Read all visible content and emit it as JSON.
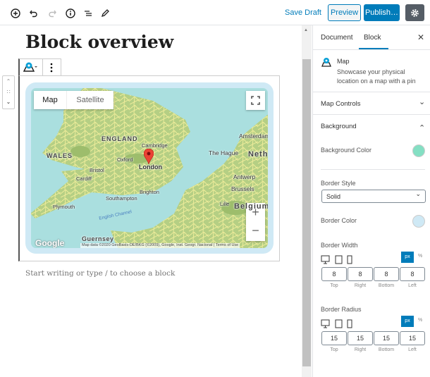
{
  "toolbar": {
    "icons": [
      "add-block-icon",
      "undo-icon",
      "redo-icon",
      "info-icon",
      "list-view-icon",
      "edit-icon"
    ],
    "save_draft": "Save Draft",
    "preview": "Preview",
    "publish": "Publish…",
    "settings_icon": "gear-icon"
  },
  "editor": {
    "title": "Block overview",
    "placeholder": "Start writing or type / to choose a block"
  },
  "map": {
    "type_map": "Map",
    "type_satellite": "Satellite",
    "attribution": "Map data ©2020 GeoBasis-DE/BKG (©2009), Google, Inst. Geogr. Nacional",
    "terms": "Terms of Use",
    "google": "Google",
    "zoom_in": "+",
    "zoom_out": "−",
    "labels": {
      "england": "ENGLAND",
      "wales": "WALES",
      "cambridge": "Cambridge",
      "oxford": "Oxford",
      "london": "London",
      "bristol": "Bristol",
      "cardiff": "Cardiff",
      "brighton": "Brighton",
      "southampton": "Southampton",
      "plymouth": "Plymouth",
      "channel": "English Channel",
      "guernsey": "Guernsey",
      "amsterdam": "Amsterdam",
      "hague": "The Hague",
      "neth": "Neth",
      "antwerp": "Antwerp",
      "brussels": "Brussels",
      "lille": "Lille",
      "belgium": "Belgium"
    },
    "colors": {
      "sea": "#aadfdf",
      "land": "#b5cf84",
      "roads": "#f2ef9c",
      "pin": "#ea4335"
    }
  },
  "sidebar": {
    "tab_document": "Document",
    "tab_block": "Block",
    "block_name": "Map",
    "block_desc": "Showcase your physical location on a map with a pin",
    "map_controls": "Map Controls",
    "background": "Background",
    "background_color_label": "Background Color",
    "background_color": "#84dfc3",
    "border_style_label": "Border Style",
    "border_style": "Solid",
    "border_color_label": "Border Color",
    "border_color": "#cfe9f5",
    "border_width_label": "Border Width",
    "border_radius_label": "Border Radius",
    "unit_px": "px",
    "unit_pct": "%",
    "border_width": [
      {
        "v": "8",
        "c": "Top"
      },
      {
        "v": "8",
        "c": "Right"
      },
      {
        "v": "8",
        "c": "Bottom"
      },
      {
        "v": "8",
        "c": "Left"
      }
    ],
    "border_radius": [
      {
        "v": "15",
        "c": "Top"
      },
      {
        "v": "15",
        "c": "Right"
      },
      {
        "v": "15",
        "c": "Bottom"
      },
      {
        "v": "15",
        "c": "Left"
      }
    ]
  }
}
